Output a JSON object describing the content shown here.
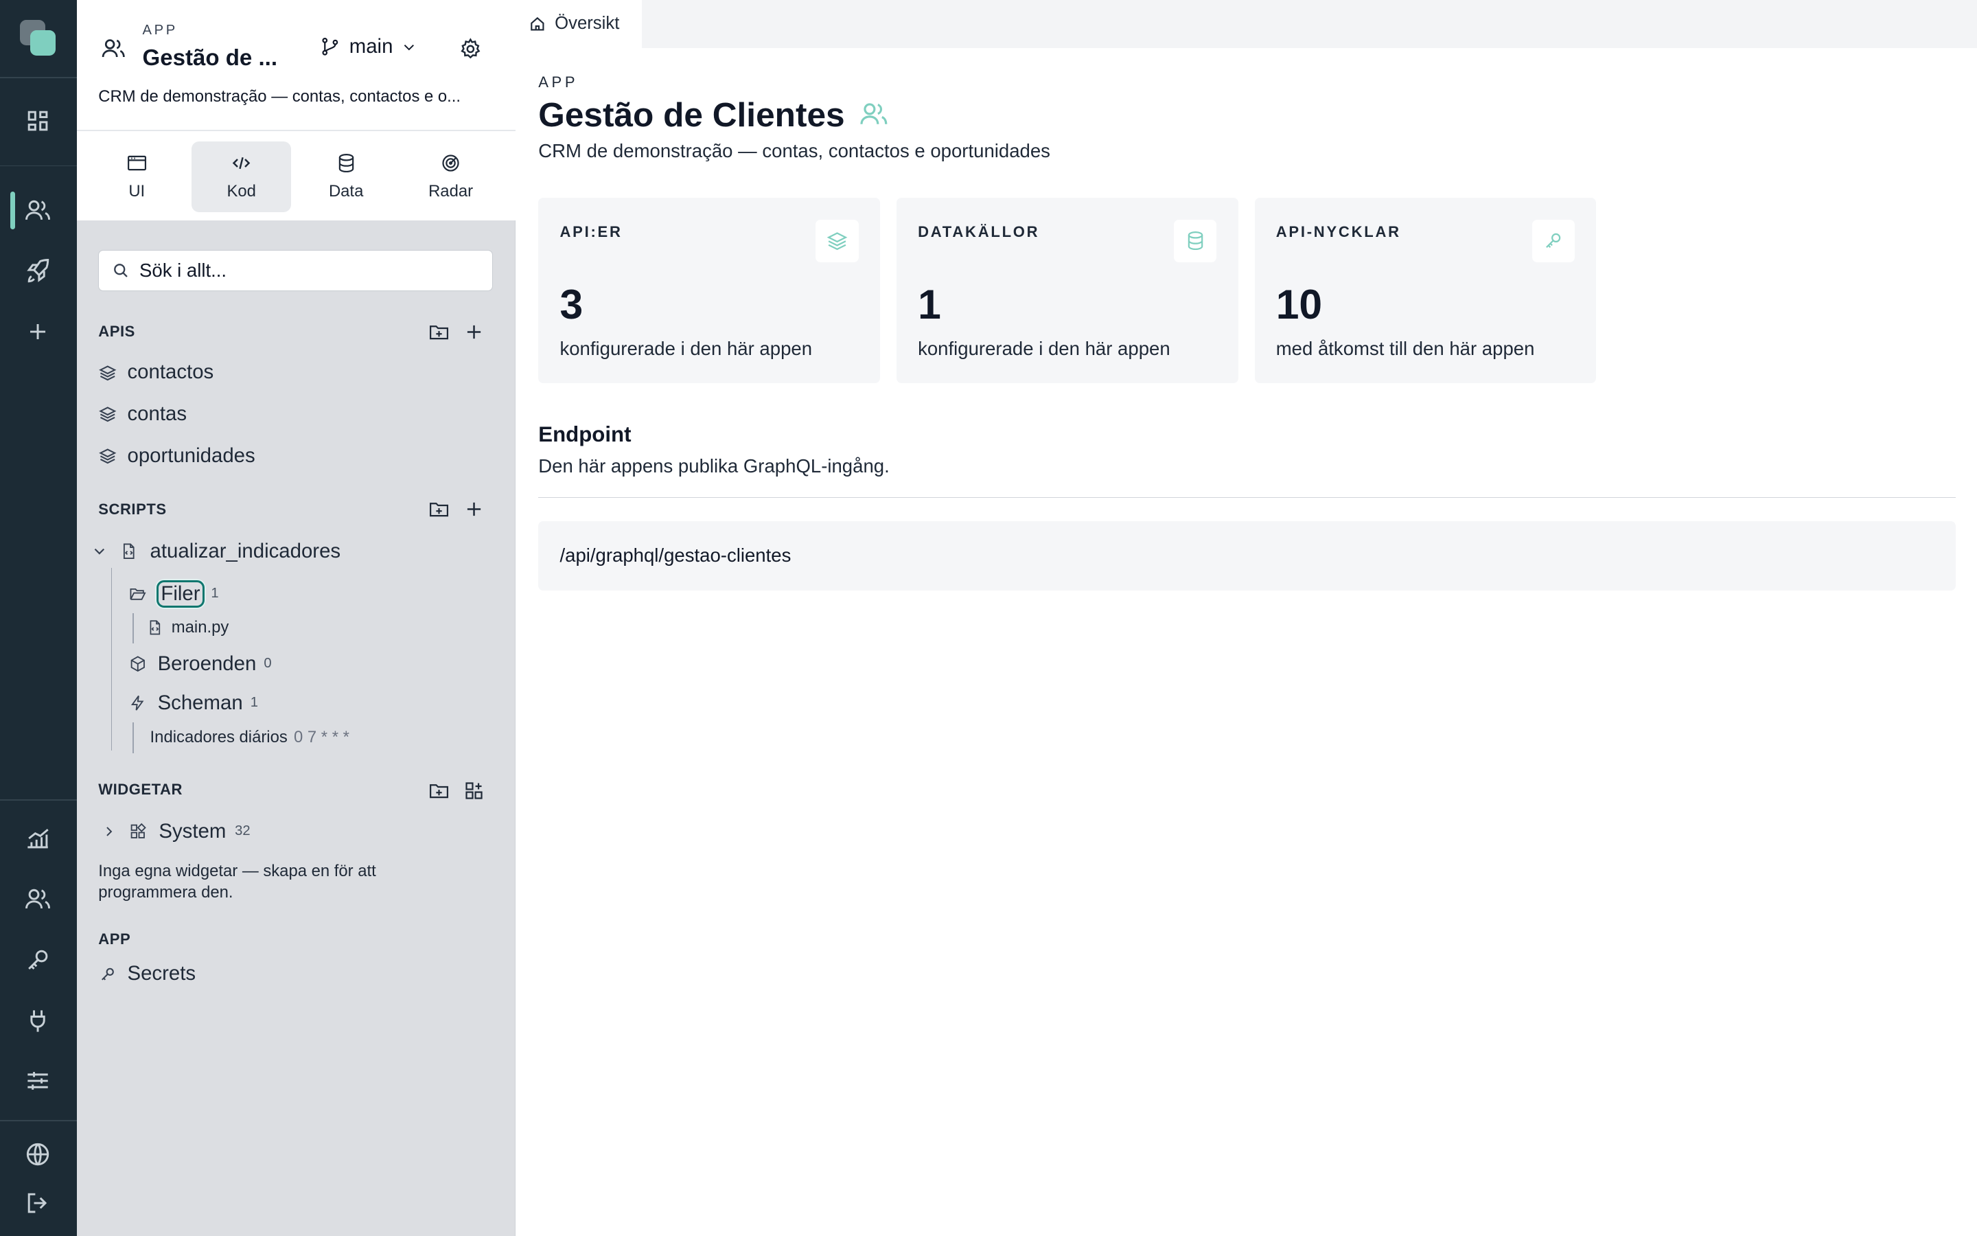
{
  "sidebar": {
    "app_kicker": "APP",
    "app_title": "Gestão de ...",
    "branch": "main",
    "app_desc": "CRM de demonstração — contas, contactos e o...",
    "tabs": [
      {
        "label": "UI",
        "icon": "window-icon"
      },
      {
        "label": "Kod",
        "icon": "code-icon",
        "active": true
      },
      {
        "label": "Data",
        "icon": "database-icon"
      },
      {
        "label": "Radar",
        "icon": "radar-icon"
      }
    ],
    "search_placeholder": "Sök i allt...",
    "apis": {
      "title": "APIS",
      "items": [
        "contactos",
        "contas",
        "oportunidades"
      ]
    },
    "scripts": {
      "title": "SCRIPTS",
      "script_name": "atualizar_indicadores",
      "files_label": "Filer",
      "files_count": "1",
      "file_name": "main.py",
      "deps_label": "Beroenden",
      "deps_count": "0",
      "schedules_label": "Scheman",
      "schedules_count": "1",
      "schedule_name": "Indicadores diários",
      "schedule_cron": "0 7 * * *"
    },
    "widgets": {
      "title": "WIDGETAR",
      "system_label": "System",
      "system_count": "32",
      "hint": "Inga egna widgetar — skapa en för att programmera den."
    },
    "app_section": {
      "title": "APP",
      "secrets_label": "Secrets"
    }
  },
  "main": {
    "tab_label": "Översikt",
    "kicker": "APP",
    "title": "Gestão de Clientes",
    "description": "CRM de demonstração — contas, contactos e oportunidades",
    "cards": [
      {
        "label": "API:ER",
        "value": "3",
        "sub": "konfigurerade i den här appen",
        "icon": "layers-icon"
      },
      {
        "label": "DATAKÄLLOR",
        "value": "1",
        "sub": "konfigurerade i den här appen",
        "icon": "database-icon"
      },
      {
        "label": "API-NYCKLAR",
        "value": "10",
        "sub": "med åtkomst till den här appen",
        "icon": "key-icon"
      }
    ],
    "endpoint": {
      "title": "Endpoint",
      "description": "Den här appens publika GraphQL-ingång.",
      "path": "/api/graphql/gestao-clientes"
    }
  },
  "colors": {
    "rail": "#1c2b35",
    "accent": "#7fcfbf",
    "focus": "#0f766e",
    "sidebar_bg": "#dcdee2"
  }
}
